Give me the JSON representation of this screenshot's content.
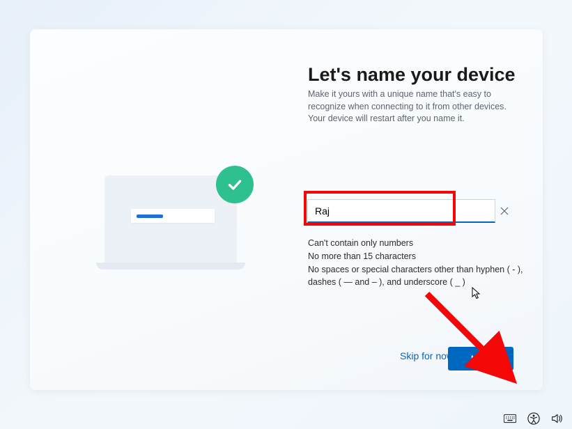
{
  "heading": "Let's name your device",
  "subtext": "Make it yours with a unique name that's easy to recognize when connecting to it from other devices. Your device will restart after you name it.",
  "input": {
    "value": "Raj",
    "placeholder": ""
  },
  "rules": {
    "line1": "Can't contain only numbers",
    "line2": "No more than 15 characters",
    "line3": "No spaces or special characters other than hyphen ( - ), dashes ( — and – ), and underscore ( _ )"
  },
  "buttons": {
    "skip": "Skip for now",
    "next": "Next"
  },
  "tray": {
    "keyboard": "keyboard-icon",
    "accessibility": "accessibility-icon",
    "volume": "volume-icon"
  }
}
